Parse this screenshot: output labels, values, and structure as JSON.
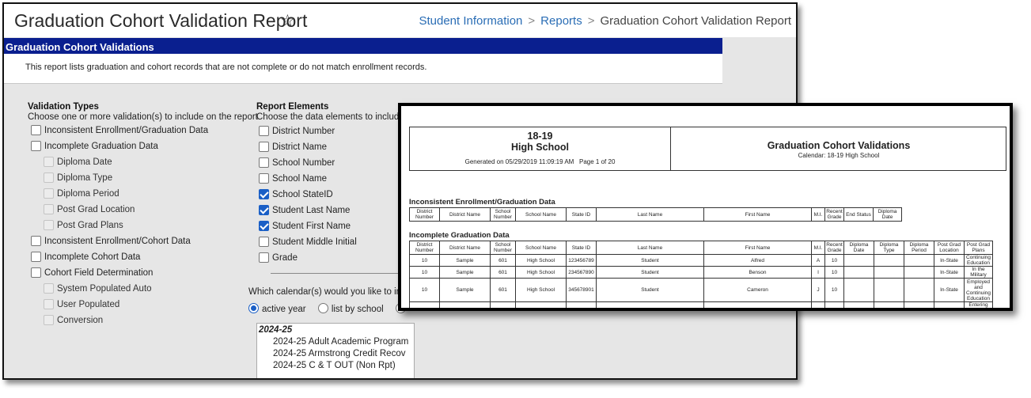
{
  "window": {
    "page_title": "Graduation Cohort Validation Report",
    "star_icon": "star-outline",
    "breadcrumb": [
      "Student Information",
      "Reports",
      "Graduation Cohort Validation Report"
    ],
    "section_bar": "Graduation Cohort Validations",
    "description": "This report lists graduation and cohort records that are not complete or do not match enrollment records."
  },
  "validation_types": {
    "heading": "Validation Types",
    "subtext": "Choose one or more validation(s) to include on the report",
    "items": [
      {
        "label": "Inconsistent Enrollment/Graduation Data",
        "checked": false,
        "disabled": false
      },
      {
        "label": "Incomplete Graduation Data",
        "checked": false,
        "disabled": false
      },
      {
        "label": "Diploma Date",
        "checked": false,
        "disabled": true
      },
      {
        "label": "Diploma Type",
        "checked": false,
        "disabled": true
      },
      {
        "label": "Diploma Period",
        "checked": false,
        "disabled": true
      },
      {
        "label": "Post Grad Location",
        "checked": false,
        "disabled": true
      },
      {
        "label": "Post Grad Plans",
        "checked": false,
        "disabled": true
      },
      {
        "label": "Inconsistent Enrollment/Cohort Data",
        "checked": false,
        "disabled": false
      },
      {
        "label": "Incomplete Cohort Data",
        "checked": false,
        "disabled": false
      },
      {
        "label": "Cohort Field Determination",
        "checked": false,
        "disabled": false
      },
      {
        "label": "System Populated Auto",
        "checked": false,
        "disabled": true
      },
      {
        "label": "User Populated",
        "checked": false,
        "disabled": true
      },
      {
        "label": "Conversion",
        "checked": false,
        "disabled": true
      }
    ]
  },
  "report_elements": {
    "heading": "Report Elements",
    "subtext": "Choose the data elements to include o",
    "items": [
      {
        "label": "District Number",
        "checked": false
      },
      {
        "label": "District Name",
        "checked": false
      },
      {
        "label": "School Number",
        "checked": false
      },
      {
        "label": "School Name",
        "checked": false
      },
      {
        "label": "School StateID",
        "checked": true
      },
      {
        "label": "Student Last Name",
        "checked": true
      },
      {
        "label": "Student First Name",
        "checked": true
      },
      {
        "label": "Student Middle Initial",
        "checked": false
      },
      {
        "label": "Grade",
        "checked": false
      }
    ]
  },
  "calendar": {
    "question": "Which calendar(s) would you like to inclu",
    "options": [
      "active year",
      "list by school"
    ],
    "selected": "active year",
    "list": {
      "group": "2024-25",
      "items": [
        "2024-25 Adult Academic Program",
        "2024-25 Armstrong Credit Recov",
        "2024-25 C & T OUT (Non Rpt)"
      ]
    }
  },
  "report_preview": {
    "year": "18-19",
    "school": "High School",
    "generated": "Generated on 05/29/2019 11:09:19 AM",
    "page": "Page 1 of 20",
    "title": "Graduation Cohort Validations",
    "calendar": "Calendar: 18-19  High School",
    "section1": {
      "title": "Inconsistent Enrollment/Graduation Data",
      "columns": [
        "District Number",
        "District Name",
        "School Number",
        "School Name",
        "State ID",
        "Last Name",
        "First Name",
        "M.I.",
        "Recent Grade",
        "End Status",
        "Diploma Date"
      ]
    },
    "section2": {
      "title": "Incomplete Graduation Data",
      "columns": [
        "District Number",
        "District Name",
        "School Number",
        "School Name",
        "State ID",
        "Last Name",
        "First Name",
        "M.I.",
        "Recent Grade",
        "Diploma Date",
        "Diploma Type",
        "Diploma Period",
        "Post Grad Location",
        "Post Grad Plans"
      ],
      "rows": [
        [
          "10",
          "Sample",
          "601",
          "High School",
          "123456789",
          "Student",
          "Alfred",
          "A",
          "10",
          "",
          "",
          "",
          "In-State",
          "Continuing Education"
        ],
        [
          "10",
          "Sample",
          "601",
          "High School",
          "234567890",
          "Student",
          "Benson",
          "I",
          "10",
          "",
          "",
          "",
          "In-State",
          "In the Military"
        ],
        [
          "10",
          "Sample",
          "601",
          "High School",
          "345678901",
          "Student",
          "Cameron",
          "J",
          "10",
          "",
          "",
          "",
          "In-State",
          "Employed and Continuing Education"
        ],
        [
          "",
          "",
          "",
          "",
          "",
          "",
          "",
          "",
          "",
          "",
          "",
          "",
          "",
          "Entering the"
        ]
      ]
    }
  }
}
